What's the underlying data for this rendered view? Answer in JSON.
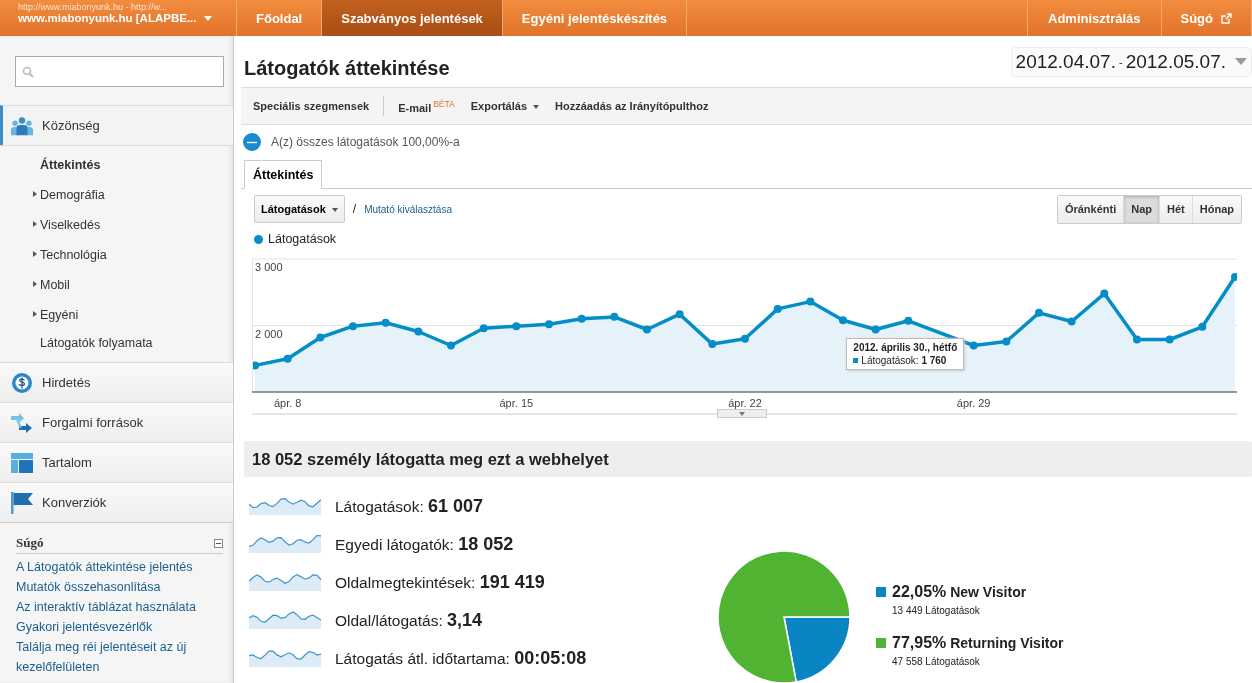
{
  "account": {
    "url": "http://www.miabonyunk.hu - http://w...",
    "name": "www.miabonyunk.hu [ALAPBE..."
  },
  "nav": [
    {
      "label": "Főoldal",
      "selected": false
    },
    {
      "label": "Szabványos jelentések",
      "selected": true
    },
    {
      "label": "Egyéni jelentéskészítés",
      "selected": false
    }
  ],
  "nav_right": [
    {
      "label": "Adminisztrálás",
      "external": false
    },
    {
      "label": "Súgó",
      "external": true
    }
  ],
  "sidebar": {
    "sections": [
      {
        "label": "Közönség",
        "selected": true,
        "children": [
          {
            "label": "Áttekintés",
            "selected": true,
            "expandable": false
          },
          {
            "label": "Demográfia",
            "selected": false,
            "expandable": true
          },
          {
            "label": "Viselkedés",
            "selected": false,
            "expandable": true
          },
          {
            "label": "Technológia",
            "selected": false,
            "expandable": true
          },
          {
            "label": "Mobil",
            "selected": false,
            "expandable": true
          },
          {
            "label": "Egyéni",
            "selected": false,
            "expandable": true
          },
          {
            "label": "Látogatók folyamata",
            "selected": false,
            "expandable": false
          }
        ]
      },
      {
        "label": "Hirdetés",
        "selected": false
      },
      {
        "label": "Forgalmi források",
        "selected": false
      },
      {
        "label": "Tartalom",
        "selected": false
      },
      {
        "label": "Konverziók",
        "selected": false
      }
    ],
    "help": {
      "title": "Súgó",
      "expanded": true,
      "links": [
        "A Látogatók áttekintése jelentés",
        "Mutatók összehasonlítása",
        "Az interaktív táblázat használata",
        "Gyakori jelentésvezérlők",
        "Találja meg réi jelentéseit az új kezelőfelületen"
      ]
    }
  },
  "page": {
    "title": "Látogatók áttekintése",
    "date_from": "2012.04.07.",
    "date_sep": "-",
    "date_to": "2012.05.07."
  },
  "toolbar": [
    {
      "label": "Speciális szegmensek",
      "dropdown": false
    },
    {
      "label": "E-mail",
      "badge": "BÉTA",
      "dropdown": false
    },
    {
      "label": "Exportálás",
      "dropdown": true
    },
    {
      "label": "Hozzáadás az Irányítópulthoz",
      "dropdown": false
    }
  ],
  "segment": "A(z) összes látogatások 100,00%-a",
  "tabs": [
    {
      "label": "Áttekintés",
      "selected": true
    }
  ],
  "metric_select": {
    "value": "Látogatások",
    "separator": "/",
    "link": "Mutató kiválasztása"
  },
  "granularity": [
    {
      "label": "Óránkénti",
      "selected": false
    },
    {
      "label": "Nap",
      "selected": true
    },
    {
      "label": "Hét",
      "selected": false
    },
    {
      "label": "Hónap",
      "selected": false
    }
  ],
  "chart": {
    "chart_data": {
      "type": "area",
      "categories": [
        null,
        "ápr. 8",
        null,
        null,
        null,
        null,
        null,
        null,
        "ápr. 15",
        null,
        null,
        null,
        null,
        null,
        null,
        "ápr. 22",
        null,
        null,
        null,
        null,
        null,
        null,
        "ápr. 29",
        null,
        null,
        null,
        null,
        null,
        null,
        null,
        null
      ],
      "series": [
        {
          "name": "Látogatások",
          "color": "#058dc7",
          "values": [
            1400,
            1500,
            1820,
            1990,
            2040,
            1910,
            1700,
            1960,
            1990,
            2020,
            2100,
            2130,
            1940,
            2170,
            1720,
            1800,
            2250,
            2360,
            2080,
            1940,
            2070,
            null,
            1700,
            1760,
            2190,
            2060,
            2480,
            1790,
            1790,
            1980,
            2730
          ]
        }
      ],
      "ylim": [
        1000,
        3000
      ],
      "yticks": [
        {
          "value": 2000,
          "label": "2 000"
        },
        {
          "value": 3000,
          "label": "3 000"
        }
      ]
    },
    "tooltip": {
      "title": "2012. április 30., hétfő",
      "text": "Látogatások: **1 760**"
    }
  },
  "summary": {
    "title": "18 052 személy látogatta meg ezt a webhelyet",
    "metrics": [
      {
        "label": "Látogatások:",
        "value": "61 007"
      },
      {
        "label": "Egyedi látogatók:",
        "value": "18 052"
      },
      {
        "label": "Oldalmegtekintések:",
        "value": "191 419"
      },
      {
        "label": "Oldal/látogatás:",
        "value": "3,14"
      },
      {
        "label": "Látogatás átl. időtartama:",
        "value": "00:05:08"
      }
    ]
  },
  "visitors": {
    "chart_data": {
      "type": "pie",
      "categories": [
        "New Visitor",
        "Returning Visitor"
      ],
      "values": [
        22.05,
        77.95
      ]
    },
    "legend": [
      {
        "percent": "22,05%",
        "count": "13 449 Látogatások",
        "color": "#0a85c4"
      },
      {
        "percent": "77,95%",
        "count": "47 558 Látogatások",
        "color": "#50b432"
      }
    ]
  }
}
